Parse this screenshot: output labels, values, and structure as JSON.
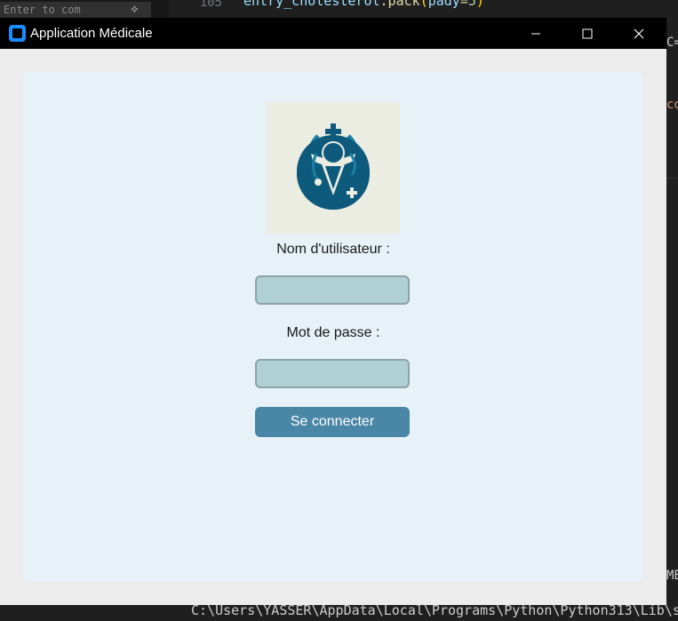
{
  "background": {
    "search_placeholder": "Enter to com",
    "code_line_number": "105",
    "code_var": "entry_cholesterol",
    "code_method": ".pack",
    "code_open": "(",
    "code_arg": "pady",
    "code_eq": "=",
    "code_val": "5",
    "code_close": ")",
    "right_a": "C=",
    "right_b": "co",
    "right_c": "ME",
    "terminal_text": "C:\\Users\\YASSER\\AppData\\Local\\Programs\\Python\\Python313\\Lib\\s"
  },
  "window": {
    "title": "Application Médicale",
    "minimize_icon": "minimize-icon",
    "maximize_icon": "maximize-icon",
    "close_icon": "close-icon"
  },
  "form": {
    "logo": "medical-doctor-logo",
    "username_label": "Nom d'utilisateur :",
    "username_value": "",
    "password_label": "Mot de passe :",
    "password_value": "",
    "login_button": "Se connecter"
  },
  "colors": {
    "panel": "#e6f1f8",
    "input_fill": "#afd0d5",
    "button": "#4a86a5",
    "logo_primary": "#0e5a7c"
  }
}
